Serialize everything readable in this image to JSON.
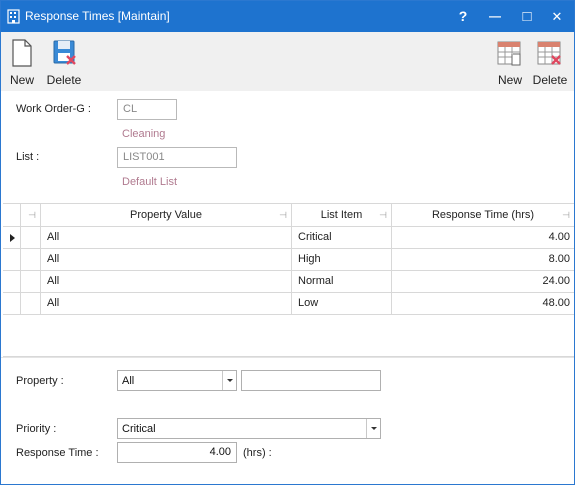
{
  "window": {
    "title": "Response Times [Maintain]",
    "help_label": "?",
    "minimize_label": "—",
    "maximize_label": "□",
    "close_label": "✕",
    "accent": "#1e73cf"
  },
  "toolbar": {
    "left": [
      {
        "label": "New",
        "icon": "new-document-icon"
      },
      {
        "label": "Delete",
        "icon": "delete-save-icon"
      }
    ],
    "right": [
      {
        "label": "New",
        "icon": "new-grid-row-icon"
      },
      {
        "label": "Delete",
        "icon": "delete-grid-row-icon"
      }
    ]
  },
  "form": {
    "work_order_label": "Work Order-G :",
    "work_order_value": "CL",
    "work_order_desc": "Cleaning",
    "list_label": "List :",
    "list_value": "LIST001",
    "list_desc": "Default List"
  },
  "grid": {
    "columns": [
      "Property Value",
      "List Item",
      "Response Time (hrs)"
    ],
    "rows": [
      {
        "property": "All",
        "item": "Critical",
        "time": "4.00"
      },
      {
        "property": "All",
        "item": "High",
        "time": "8.00"
      },
      {
        "property": "All",
        "item": "Normal",
        "time": "24.00"
      },
      {
        "property": "All",
        "item": "Low",
        "time": "48.00"
      }
    ]
  },
  "detail": {
    "property_label": "Property :",
    "property_value": "All",
    "property_extra": "",
    "priority_label": "Priority :",
    "priority_value": "Critical",
    "response_label": "Response Time :",
    "response_value": "4.00",
    "response_unit": "(hrs) :"
  }
}
